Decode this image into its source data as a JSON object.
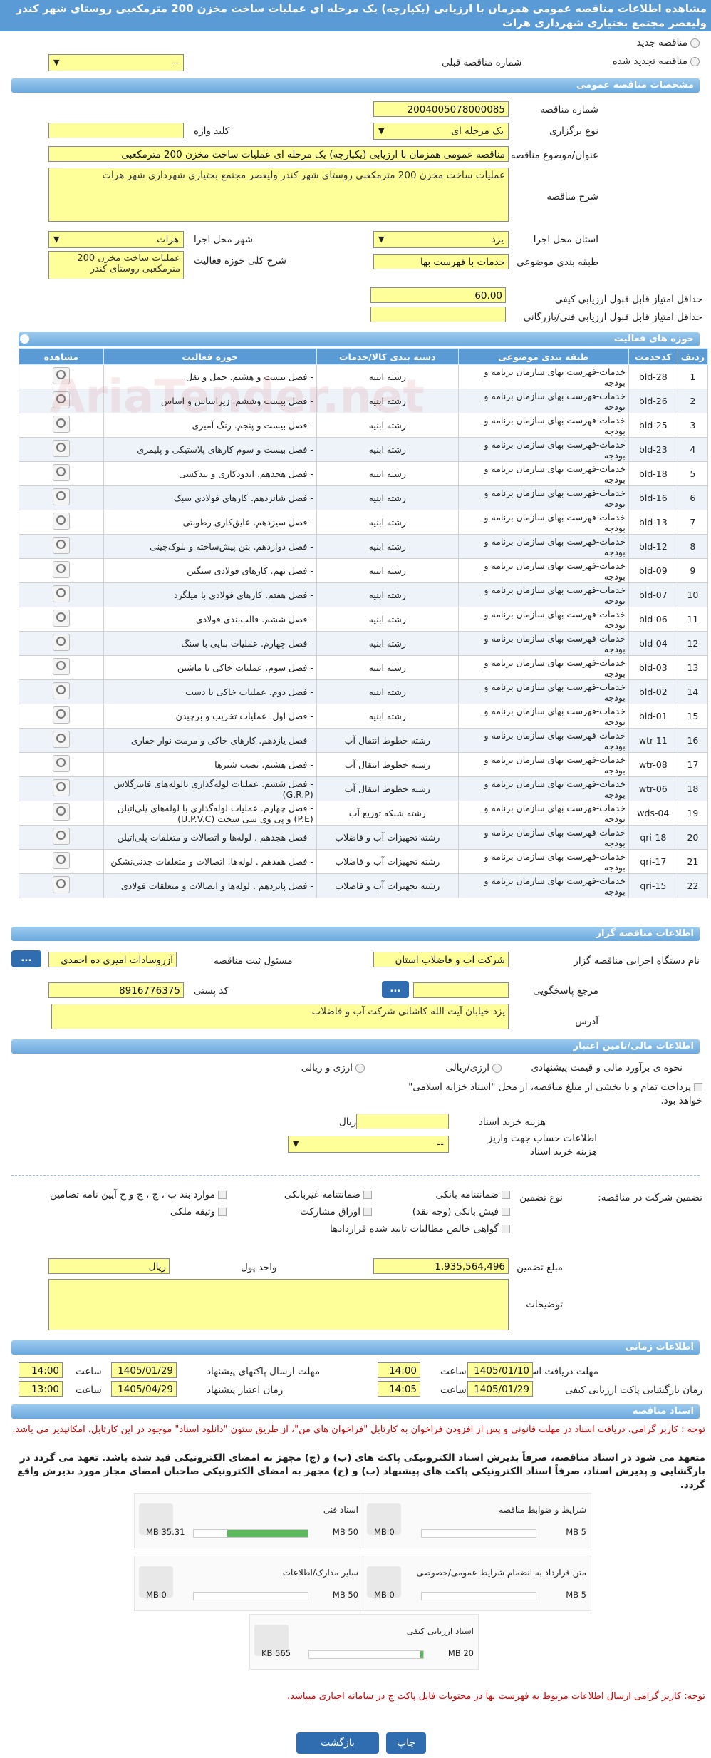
{
  "page_title": "مشاهده اطلاعات مناقصه عمومی همزمان با ارزیابی (یکپارچه) یک مرحله ای عملیات ساخت مخزن 200 مترمکعبی روستای شهر کندر ولیعصر مجتمع بختیاری شهرداری هرات",
  "tender_type": {
    "new": "مناقصه جدید",
    "renewed": "مناقصه تجدید شده",
    "prev_number_label": "شماره مناقصه قبلی",
    "prev_number_value": "--"
  },
  "general": {
    "header": "مشخصات مناقصه عمومی",
    "number_label": "شماره مناقصه",
    "number_value": "2004005078000085",
    "holding_type_label": "نوع برگزاری",
    "holding_type_value": "یک مرحله ای",
    "keyword_label": "کلید واژه",
    "subject_label": "عنوان/موضوع مناقصه",
    "subject_value": "مناقصه عمومی همزمان با ارزیابی (یکپارچه) یک مرحله ای عملیات ساخت مخزن 200 مترمکعبی",
    "description_label": "شرح مناقصه",
    "description_value": "عملیات ساخت مخزن 200 مترمکعبی روستای شهر کندر ولیعصر مجتمع بختیاری شهرداری شهر هرات",
    "province_label": "استان محل اجرا",
    "province_value": "یزد",
    "city_label": "شهر محل اجرا",
    "city_value": "هرات",
    "category_label": "طبقه بندی موضوعی",
    "category_value": "خدمات با فهرست بها",
    "activity_desc_label": "شرح کلی حوزه فعالیت",
    "activity_desc_value": "عملیات ساخت مخزن 200 مترمکعبی روستای کندر",
    "min_quality_label": "حداقل امتیاز قابل قبول ارزیابی کیفی",
    "min_quality_value": "60.00",
    "min_tech_label": "حداقل امتیاز قابل قبول ارزیابی فنی/بازرگانی"
  },
  "activities": {
    "header": "حوزه های فعالیت",
    "columns": [
      "ردیف",
      "کدخدمت",
      "طبقه بندی موضوعی",
      "دسته بندی کالا/خدمات",
      "حوزه فعالیت",
      "مشاهده"
    ],
    "rows": [
      {
        "idx": "1",
        "code": "bld-28",
        "cat": "خدمات-فهرست بهای سازمان برنامه و بودجه",
        "group": "رشته ابنیه",
        "field": "- فصل بیست و هشتم. حمل و نقل"
      },
      {
        "idx": "2",
        "code": "bld-26",
        "cat": "خدمات-فهرست بهای سازمان برنامه و بودجه",
        "group": "رشته ابنیه",
        "field": "- فصل بیست وششم. زیراساس و اساس"
      },
      {
        "idx": "3",
        "code": "bld-25",
        "cat": "خدمات-فهرست بهای سازمان برنامه و بودجه",
        "group": "رشته ابنیه",
        "field": "- فصل بیست و پنجم. رنگ آمیزی"
      },
      {
        "idx": "4",
        "code": "bld-23",
        "cat": "خدمات-فهرست بهای سازمان برنامه و بودجه",
        "group": "رشته ابنیه",
        "field": "- فصل بیست و سوم کارهای پلاستیکی و پلیمری"
      },
      {
        "idx": "5",
        "code": "bld-18",
        "cat": "خدمات-فهرست بهای سازمان برنامه و بودجه",
        "group": "رشته ابنیه",
        "field": "- فصل هجدهم. اندودکاری و بندکشی"
      },
      {
        "idx": "6",
        "code": "bld-16",
        "cat": "خدمات-فهرست بهای سازمان برنامه و بودجه",
        "group": "رشته ابنیه",
        "field": "- فصل شانزدهم. کارهای فولادی سبک"
      },
      {
        "idx": "7",
        "code": "bld-13",
        "cat": "خدمات-فهرست بهای سازمان برنامه و بودجه",
        "group": "رشته ابنیه",
        "field": "- فصل سیزدهم. عایق‌کاری رطوبتی"
      },
      {
        "idx": "8",
        "code": "bld-12",
        "cat": "خدمات-فهرست بهای سازمان برنامه و بودجه",
        "group": "رشته ابنیه",
        "field": "- فصل دوازدهم. بتن پیش‌ساخته و بلوک‌چینی"
      },
      {
        "idx": "9",
        "code": "bld-09",
        "cat": "خدمات-فهرست بهای سازمان برنامه و بودجه",
        "group": "رشته ابنیه",
        "field": "- فصل نهم. کارهای فولادی سنگین"
      },
      {
        "idx": "10",
        "code": "bld-07",
        "cat": "خدمات-فهرست بهای سازمان برنامه و بودجه",
        "group": "رشته ابنیه",
        "field": "- فصل هفتم. کارهای فولادی با میلگرد"
      },
      {
        "idx": "11",
        "code": "bld-06",
        "cat": "خدمات-فهرست بهای سازمان برنامه و بودجه",
        "group": "رشته ابنیه",
        "field": "- فصل ششم. قالب‌بندی فولادی"
      },
      {
        "idx": "12",
        "code": "bld-04",
        "cat": "خدمات-فهرست بهای سازمان برنامه و بودجه",
        "group": "رشته ابنیه",
        "field": "- فصل چهارم. عملیات بنایی با سنگ"
      },
      {
        "idx": "13",
        "code": "bld-03",
        "cat": "خدمات-فهرست بهای سازمان برنامه و بودجه",
        "group": "رشته ابنیه",
        "field": "- فصل سوم. عملیات خاکی با ماشین"
      },
      {
        "idx": "14",
        "code": "bld-02",
        "cat": "خدمات-فهرست بهای سازمان برنامه و بودجه",
        "group": "رشته ابنیه",
        "field": "- فصل دوم. عملیات خاکی با دست"
      },
      {
        "idx": "15",
        "code": "bld-01",
        "cat": "خدمات-فهرست بهای سازمان برنامه و بودجه",
        "group": "رشته ابنیه",
        "field": "- فصل اول. عملیات تخریب و برچیدن"
      },
      {
        "idx": "16",
        "code": "wtr-11",
        "cat": "خدمات-فهرست بهای سازمان برنامه و بودجه",
        "group": "رشته خطوط انتقال آب",
        "field": "- فصل یازدهم. کارهای خاکی و مرمت نوار حفاری"
      },
      {
        "idx": "17",
        "code": "wtr-08",
        "cat": "خدمات-فهرست بهای سازمان برنامه و بودجه",
        "group": "رشته خطوط انتقال آب",
        "field": "- فصل هشتم. نصب شیرها"
      },
      {
        "idx": "18",
        "code": "wtr-06",
        "cat": "خدمات-فهرست بهای سازمان برنامه و بودجه",
        "group": "رشته خطوط انتقال آب",
        "field": "- فصل ششم. عملیات لوله‌گذاری بالوله‌های فایبرگلاس (G.R.P)"
      },
      {
        "idx": "19",
        "code": "wds-04",
        "cat": "خدمات-فهرست بهای سازمان برنامه و بودجه",
        "group": "رشته شبکه توزیع آب",
        "field": "- فصل چهارم. عملیات لوله‌گذاری با لوله‌های پلی‌اتیلن (P.E) و پی وی سی سخت (U.P.V.C)"
      },
      {
        "idx": "20",
        "code": "qri-18",
        "cat": "خدمات-فهرست بهای سازمان برنامه و بودجه",
        "group": "رشته تجهیزات آب و فاضلاب",
        "field": "- فصل هجدهم . لوله‌ها و اتصالات و متعلقات پلی‌اتیلن"
      },
      {
        "idx": "21",
        "code": "qri-17",
        "cat": "خدمات-فهرست بهای سازمان برنامه و بودجه",
        "group": "رشته تجهیزات آب و فاضلاب",
        "field": "- فصل هفدهم . لوله‌ها، اتصالات و متعلقات چدنی‌نشکن"
      },
      {
        "idx": "22",
        "code": "qri-15",
        "cat": "خدمات-فهرست بهای سازمان برنامه و بودجه",
        "group": "رشته تجهیزات آب و فاضلاب",
        "field": "- فصل پانزدهم . لوله‌ها و اتصالات و متعلقات فولادی"
      }
    ]
  },
  "organizer": {
    "header": "اطلاعات مناقصه گزار",
    "exec_label": "نام دستگاه اجرایی مناقصه گزار",
    "exec_value": "شرکت آب و فاضلاب استان",
    "officer_label": "مسئول ثبت مناقصه",
    "officer_value": "آزروسادات امیری ده احمدی",
    "ref_label": "مرجع پاسخگویی",
    "postal_label": "کد پستی",
    "postal_value": "8916776375",
    "address_label": "آدرس",
    "address_value": "یزد خیابان آیت الله کاشانی شرکت آب و فاضلاب",
    "dots": "..."
  },
  "financial": {
    "header": "اطلاعات مالی/تامین اعتبار",
    "estimate_label": "نحوه ی برآورد مالی و قیمت پیشنهادی",
    "opt1": "ارزی/ریالی",
    "opt2": "ارزی و ریالی",
    "payment_text": "پرداخت تمام و یا بخشی از مبلغ مناقصه، از محل \"اسناد خزانه اسلامی\" خواهد بود.",
    "doc_cost_label": "هزینه خرید اسناد",
    "doc_cost_unit": "ریال",
    "account_label": "اطلاعات حساب جهت واریز هزینه خرید اسناد",
    "account_value": "--"
  },
  "guarantee": {
    "participation_label": "تضمین شرکت در مناقصه:",
    "type_label": "نوع تضمین",
    "opts": [
      "ضمانتنامه بانکی",
      "ضمانتنامه غیربانکی",
      "موارد بند ب ، ج ، چ و خ آیین نامه تضامین",
      "فیش بانکی (وجه نقد)",
      "اوراق مشارکت",
      "وثیقه ملکی",
      "گواهی خالص مطالبات تایید شده قراردادها"
    ],
    "amount_label": "مبلغ تضمین",
    "amount_value": "1,935,564,496",
    "unit_label": "واحد پول",
    "unit_value": "ریال",
    "notes_label": "توضیحات"
  },
  "timing": {
    "header": "اطلاعات زمانی",
    "receive_label": "مهلت دریافت اسناد",
    "receive_date": "1405/01/10",
    "receive_time": "14:00",
    "send_label": "مهلت ارسال پاکتهای پیشنهاد",
    "send_date": "1405/01/29",
    "send_time": "14:00",
    "open_label": "زمان بازگشایی پاکت ارزیابی کیفی",
    "open_date": "1405/01/29",
    "open_time": "14:05",
    "validity_label": "زمان اعتبار پیشنهاد",
    "validity_date": "1405/04/29",
    "validity_time": "13:00",
    "time_label": "ساعت"
  },
  "documents": {
    "header": "اسناد مناقصه",
    "note1": "توجه : کاربر گرامی، دریافت اسناد در مهلت قانونی و پس از افزودن فراخوان به کارتابل \"فراخوان های من\"، از طریق ستون \"دانلود اسناد\" موجود در این کارتابل، امکانپذیر می باشد.",
    "note2": "متعهد می شود در اسناد مناقصه، صرفاً بذیرش اسناد الکترونیکی پاکت های (ب) و (ج) مجهز به امضای الکترونیکی قید شده باشد. تعهد می گردد در بارگشایی و پذیرش اسناد، صرفاً اسناد الکترونیکی پاکت های پیشنهاد (ب) و (ج) مجهز به امضای الکترونیکی صاحبان امضای مجاز مورد بذیرش واقع گردد.",
    "cards": [
      {
        "name": "شرایط و ضوابط مناقصه",
        "max": "5 MB",
        "current": "0 MB",
        "progress": 0
      },
      {
        "name": "اسناد فنی",
        "max": "50 MB",
        "current": "35.31 MB",
        "progress": 0.706
      },
      {
        "name": "متن قرارداد به انضمام شرایط عمومی/خصوصی",
        "max": "5 MB",
        "current": "0 MB",
        "progress": 0
      },
      {
        "name": "سایر مدارک/اطلاعات",
        "max": "50 MB",
        "current": "0 MB",
        "progress": 0
      },
      {
        "name": "اسناد ارزیابی کیفی",
        "max": "20 MB",
        "current": "565 KB",
        "progress": 0.028
      }
    ],
    "note3": "توجه: کاربر گرامی ارسال اطلاعات مربوط به فهرست بها در محتویات فایل پاکت ج در سامانه اجباری میباشد."
  },
  "buttons": {
    "print": "چاپ",
    "back": "بازگشت"
  },
  "watermark": "AriaTender.net"
}
